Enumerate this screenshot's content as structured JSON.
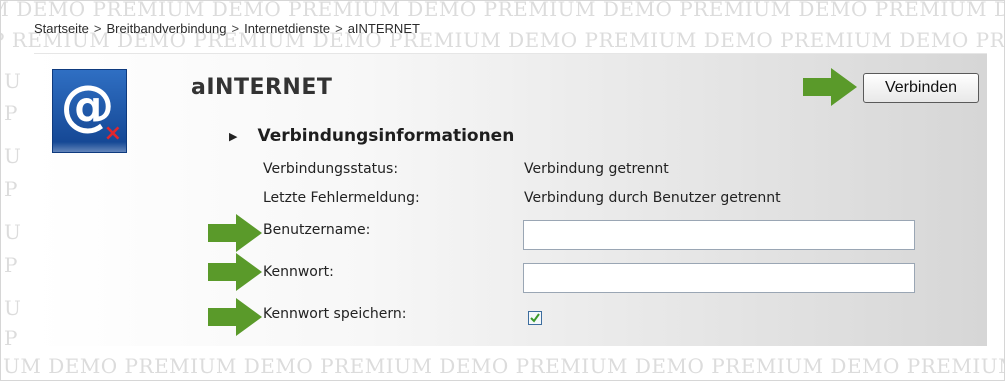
{
  "breadcrumb": {
    "items": [
      "Startseite",
      "Breitbandverbindung",
      "Internetdienste",
      "aINTERNET"
    ],
    "separator": ">"
  },
  "watermark": {
    "text": "DEMO PREMIUM"
  },
  "header": {
    "title": "aINTERNET",
    "connect_button": "Verbinden"
  },
  "section": {
    "title": "Verbindungsinformationen",
    "rows": [
      {
        "label": "Verbindungsstatus:",
        "value": "Verbindung getrennt"
      },
      {
        "label": "Letzte Fehlermeldung:",
        "value": "Verbindung durch Benutzer getrennt"
      }
    ]
  },
  "form": {
    "username_label": "Benutzername:",
    "username_value": "",
    "password_label": "Kennwort:",
    "password_value": "",
    "save_password_label": "Kennwort speichern:",
    "save_password_checked": true
  },
  "icons": {
    "app_icon": "at-sign-disconnected-icon",
    "arrow": "green-arrow-icon"
  },
  "colors": {
    "arrow_green": "#5a9a2a",
    "check_green": "#3a9a2a",
    "icon_blue": "#1f5aab",
    "disconnected_red": "#e0262e"
  }
}
